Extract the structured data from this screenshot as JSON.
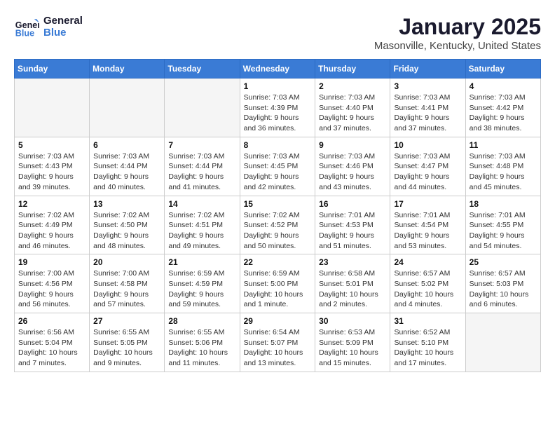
{
  "header": {
    "logo_line1": "General",
    "logo_line2": "Blue",
    "month": "January 2025",
    "location": "Masonville, Kentucky, United States"
  },
  "weekdays": [
    "Sunday",
    "Monday",
    "Tuesday",
    "Wednesday",
    "Thursday",
    "Friday",
    "Saturday"
  ],
  "weeks": [
    [
      {
        "day": "",
        "info": ""
      },
      {
        "day": "",
        "info": ""
      },
      {
        "day": "",
        "info": ""
      },
      {
        "day": "1",
        "info": "Sunrise: 7:03 AM\nSunset: 4:39 PM\nDaylight: 9 hours and 36 minutes."
      },
      {
        "day": "2",
        "info": "Sunrise: 7:03 AM\nSunset: 4:40 PM\nDaylight: 9 hours and 37 minutes."
      },
      {
        "day": "3",
        "info": "Sunrise: 7:03 AM\nSunset: 4:41 PM\nDaylight: 9 hours and 37 minutes."
      },
      {
        "day": "4",
        "info": "Sunrise: 7:03 AM\nSunset: 4:42 PM\nDaylight: 9 hours and 38 minutes."
      }
    ],
    [
      {
        "day": "5",
        "info": "Sunrise: 7:03 AM\nSunset: 4:43 PM\nDaylight: 9 hours and 39 minutes."
      },
      {
        "day": "6",
        "info": "Sunrise: 7:03 AM\nSunset: 4:44 PM\nDaylight: 9 hours and 40 minutes."
      },
      {
        "day": "7",
        "info": "Sunrise: 7:03 AM\nSunset: 4:44 PM\nDaylight: 9 hours and 41 minutes."
      },
      {
        "day": "8",
        "info": "Sunrise: 7:03 AM\nSunset: 4:45 PM\nDaylight: 9 hours and 42 minutes."
      },
      {
        "day": "9",
        "info": "Sunrise: 7:03 AM\nSunset: 4:46 PM\nDaylight: 9 hours and 43 minutes."
      },
      {
        "day": "10",
        "info": "Sunrise: 7:03 AM\nSunset: 4:47 PM\nDaylight: 9 hours and 44 minutes."
      },
      {
        "day": "11",
        "info": "Sunrise: 7:03 AM\nSunset: 4:48 PM\nDaylight: 9 hours and 45 minutes."
      }
    ],
    [
      {
        "day": "12",
        "info": "Sunrise: 7:02 AM\nSunset: 4:49 PM\nDaylight: 9 hours and 46 minutes."
      },
      {
        "day": "13",
        "info": "Sunrise: 7:02 AM\nSunset: 4:50 PM\nDaylight: 9 hours and 48 minutes."
      },
      {
        "day": "14",
        "info": "Sunrise: 7:02 AM\nSunset: 4:51 PM\nDaylight: 9 hours and 49 minutes."
      },
      {
        "day": "15",
        "info": "Sunrise: 7:02 AM\nSunset: 4:52 PM\nDaylight: 9 hours and 50 minutes."
      },
      {
        "day": "16",
        "info": "Sunrise: 7:01 AM\nSunset: 4:53 PM\nDaylight: 9 hours and 51 minutes."
      },
      {
        "day": "17",
        "info": "Sunrise: 7:01 AM\nSunset: 4:54 PM\nDaylight: 9 hours and 53 minutes."
      },
      {
        "day": "18",
        "info": "Sunrise: 7:01 AM\nSunset: 4:55 PM\nDaylight: 9 hours and 54 minutes."
      }
    ],
    [
      {
        "day": "19",
        "info": "Sunrise: 7:00 AM\nSunset: 4:56 PM\nDaylight: 9 hours and 56 minutes."
      },
      {
        "day": "20",
        "info": "Sunrise: 7:00 AM\nSunset: 4:58 PM\nDaylight: 9 hours and 57 minutes."
      },
      {
        "day": "21",
        "info": "Sunrise: 6:59 AM\nSunset: 4:59 PM\nDaylight: 9 hours and 59 minutes."
      },
      {
        "day": "22",
        "info": "Sunrise: 6:59 AM\nSunset: 5:00 PM\nDaylight: 10 hours and 1 minute."
      },
      {
        "day": "23",
        "info": "Sunrise: 6:58 AM\nSunset: 5:01 PM\nDaylight: 10 hours and 2 minutes."
      },
      {
        "day": "24",
        "info": "Sunrise: 6:57 AM\nSunset: 5:02 PM\nDaylight: 10 hours and 4 minutes."
      },
      {
        "day": "25",
        "info": "Sunrise: 6:57 AM\nSunset: 5:03 PM\nDaylight: 10 hours and 6 minutes."
      }
    ],
    [
      {
        "day": "26",
        "info": "Sunrise: 6:56 AM\nSunset: 5:04 PM\nDaylight: 10 hours and 7 minutes."
      },
      {
        "day": "27",
        "info": "Sunrise: 6:55 AM\nSunset: 5:05 PM\nDaylight: 10 hours and 9 minutes."
      },
      {
        "day": "28",
        "info": "Sunrise: 6:55 AM\nSunset: 5:06 PM\nDaylight: 10 hours and 11 minutes."
      },
      {
        "day": "29",
        "info": "Sunrise: 6:54 AM\nSunset: 5:07 PM\nDaylight: 10 hours and 13 minutes."
      },
      {
        "day": "30",
        "info": "Sunrise: 6:53 AM\nSunset: 5:09 PM\nDaylight: 10 hours and 15 minutes."
      },
      {
        "day": "31",
        "info": "Sunrise: 6:52 AM\nSunset: 5:10 PM\nDaylight: 10 hours and 17 minutes."
      },
      {
        "day": "",
        "info": ""
      }
    ]
  ]
}
